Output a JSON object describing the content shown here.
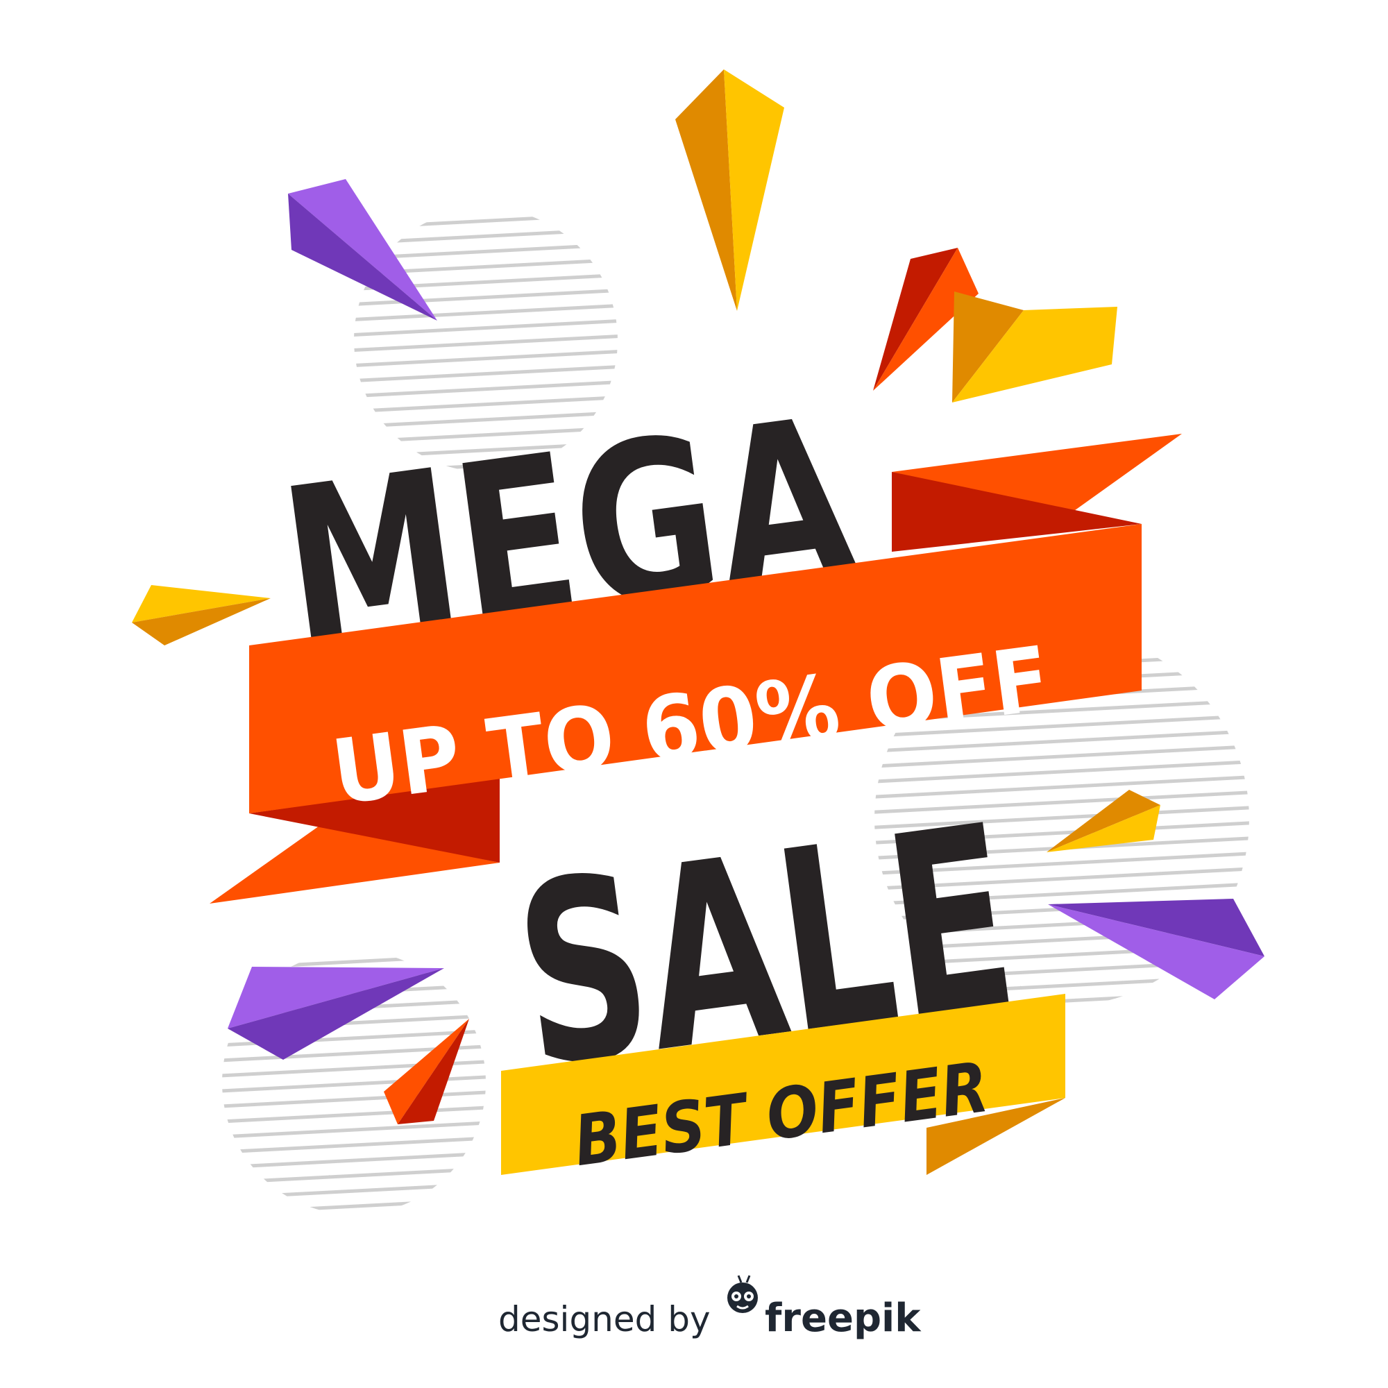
{
  "headline": {
    "top_word": "MEGA",
    "bottom_word": "SALE"
  },
  "discount_banner": {
    "text": "UP TO 60% OFF"
  },
  "offer_banner": {
    "text": "BEST OFFER"
  },
  "credit": {
    "prefix": "designed by",
    "brand": "freepik"
  },
  "colors": {
    "background": "#ffffff",
    "headline_text": "#272324",
    "orange_ribbon": "#ff5000",
    "orange_ribbon_fold": "#c31b00",
    "yellow_ribbon": "#ffc500",
    "yellow_ribbon_fold": "#e08a00",
    "purple_light": "#a05ee8",
    "purple_dark": "#7038b8",
    "stripe_gray": "#cfcfcf"
  },
  "icons": [
    "freepik-logo-icon"
  ]
}
